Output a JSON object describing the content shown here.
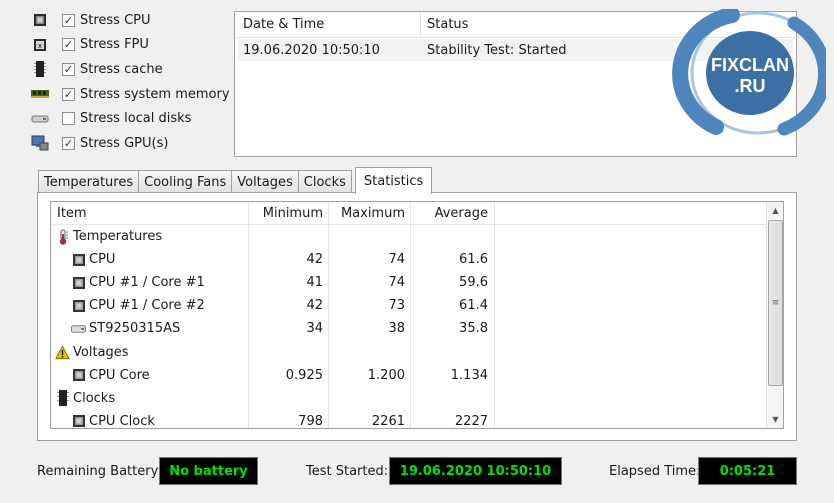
{
  "stress_options": [
    {
      "label": "Stress CPU",
      "checked": true,
      "icon": "cpu-icon"
    },
    {
      "label": "Stress FPU",
      "checked": true,
      "icon": "fpu-icon"
    },
    {
      "label": "Stress cache",
      "checked": true,
      "icon": "cache-icon"
    },
    {
      "label": "Stress system memory",
      "checked": true,
      "icon": "memory-icon"
    },
    {
      "label": "Stress local disks",
      "checked": false,
      "icon": "disk-icon"
    },
    {
      "label": "Stress GPU(s)",
      "checked": true,
      "icon": "gpu-icon"
    }
  ],
  "log": {
    "headers": {
      "date": "Date & Time",
      "status": "Status"
    },
    "rows": [
      {
        "date": "19.06.2020 10:50:10",
        "status": "Stability Test: Started"
      }
    ]
  },
  "watermark": {
    "line1": "FIXCLAN",
    "line2": ".RU"
  },
  "tabs": [
    "Temperatures",
    "Cooling Fans",
    "Voltages",
    "Clocks",
    "Statistics"
  ],
  "active_tab": "Statistics",
  "stats": {
    "headers": {
      "item": "Item",
      "min": "Minimum",
      "max": "Maximum",
      "avg": "Average"
    },
    "rows": [
      {
        "type": "group",
        "icon": "thermometer-icon",
        "item": "Temperatures",
        "min": "",
        "max": "",
        "avg": ""
      },
      {
        "type": "item",
        "icon": "chip-icon",
        "item": "CPU",
        "min": "42",
        "max": "74",
        "avg": "61.6"
      },
      {
        "type": "item",
        "icon": "chip-icon",
        "item": "CPU #1 / Core #1",
        "min": "41",
        "max": "74",
        "avg": "59.6"
      },
      {
        "type": "item",
        "icon": "chip-icon",
        "item": "CPU #1 / Core #2",
        "min": "42",
        "max": "73",
        "avg": "61.4"
      },
      {
        "type": "item",
        "icon": "hdd-icon",
        "item": "ST9250315AS",
        "min": "34",
        "max": "38",
        "avg": "35.8"
      },
      {
        "type": "group",
        "icon": "warning-icon",
        "item": "Voltages",
        "min": "",
        "max": "",
        "avg": ""
      },
      {
        "type": "item",
        "icon": "chip-icon",
        "item": "CPU Core",
        "min": "0.925",
        "max": "1.200",
        "avg": "1.134"
      },
      {
        "type": "group",
        "icon": "clock-chip-icon",
        "item": "Clocks",
        "min": "",
        "max": "",
        "avg": ""
      },
      {
        "type": "item",
        "icon": "chip-icon",
        "item": "CPU Clock",
        "min": "798",
        "max": "2261",
        "avg": "2227"
      }
    ]
  },
  "footer": {
    "battery_label": "Remaining Battery:",
    "battery_value": "No battery",
    "started_label": "Test Started:",
    "started_value": "19.06.2020 10:50:10",
    "elapsed_label": "Elapsed Time:",
    "elapsed_value": "0:05:21"
  },
  "colors": {
    "lcd_bg": "#000000",
    "lcd_text": "#00e000",
    "badge_blue": "#3c6fa4"
  }
}
